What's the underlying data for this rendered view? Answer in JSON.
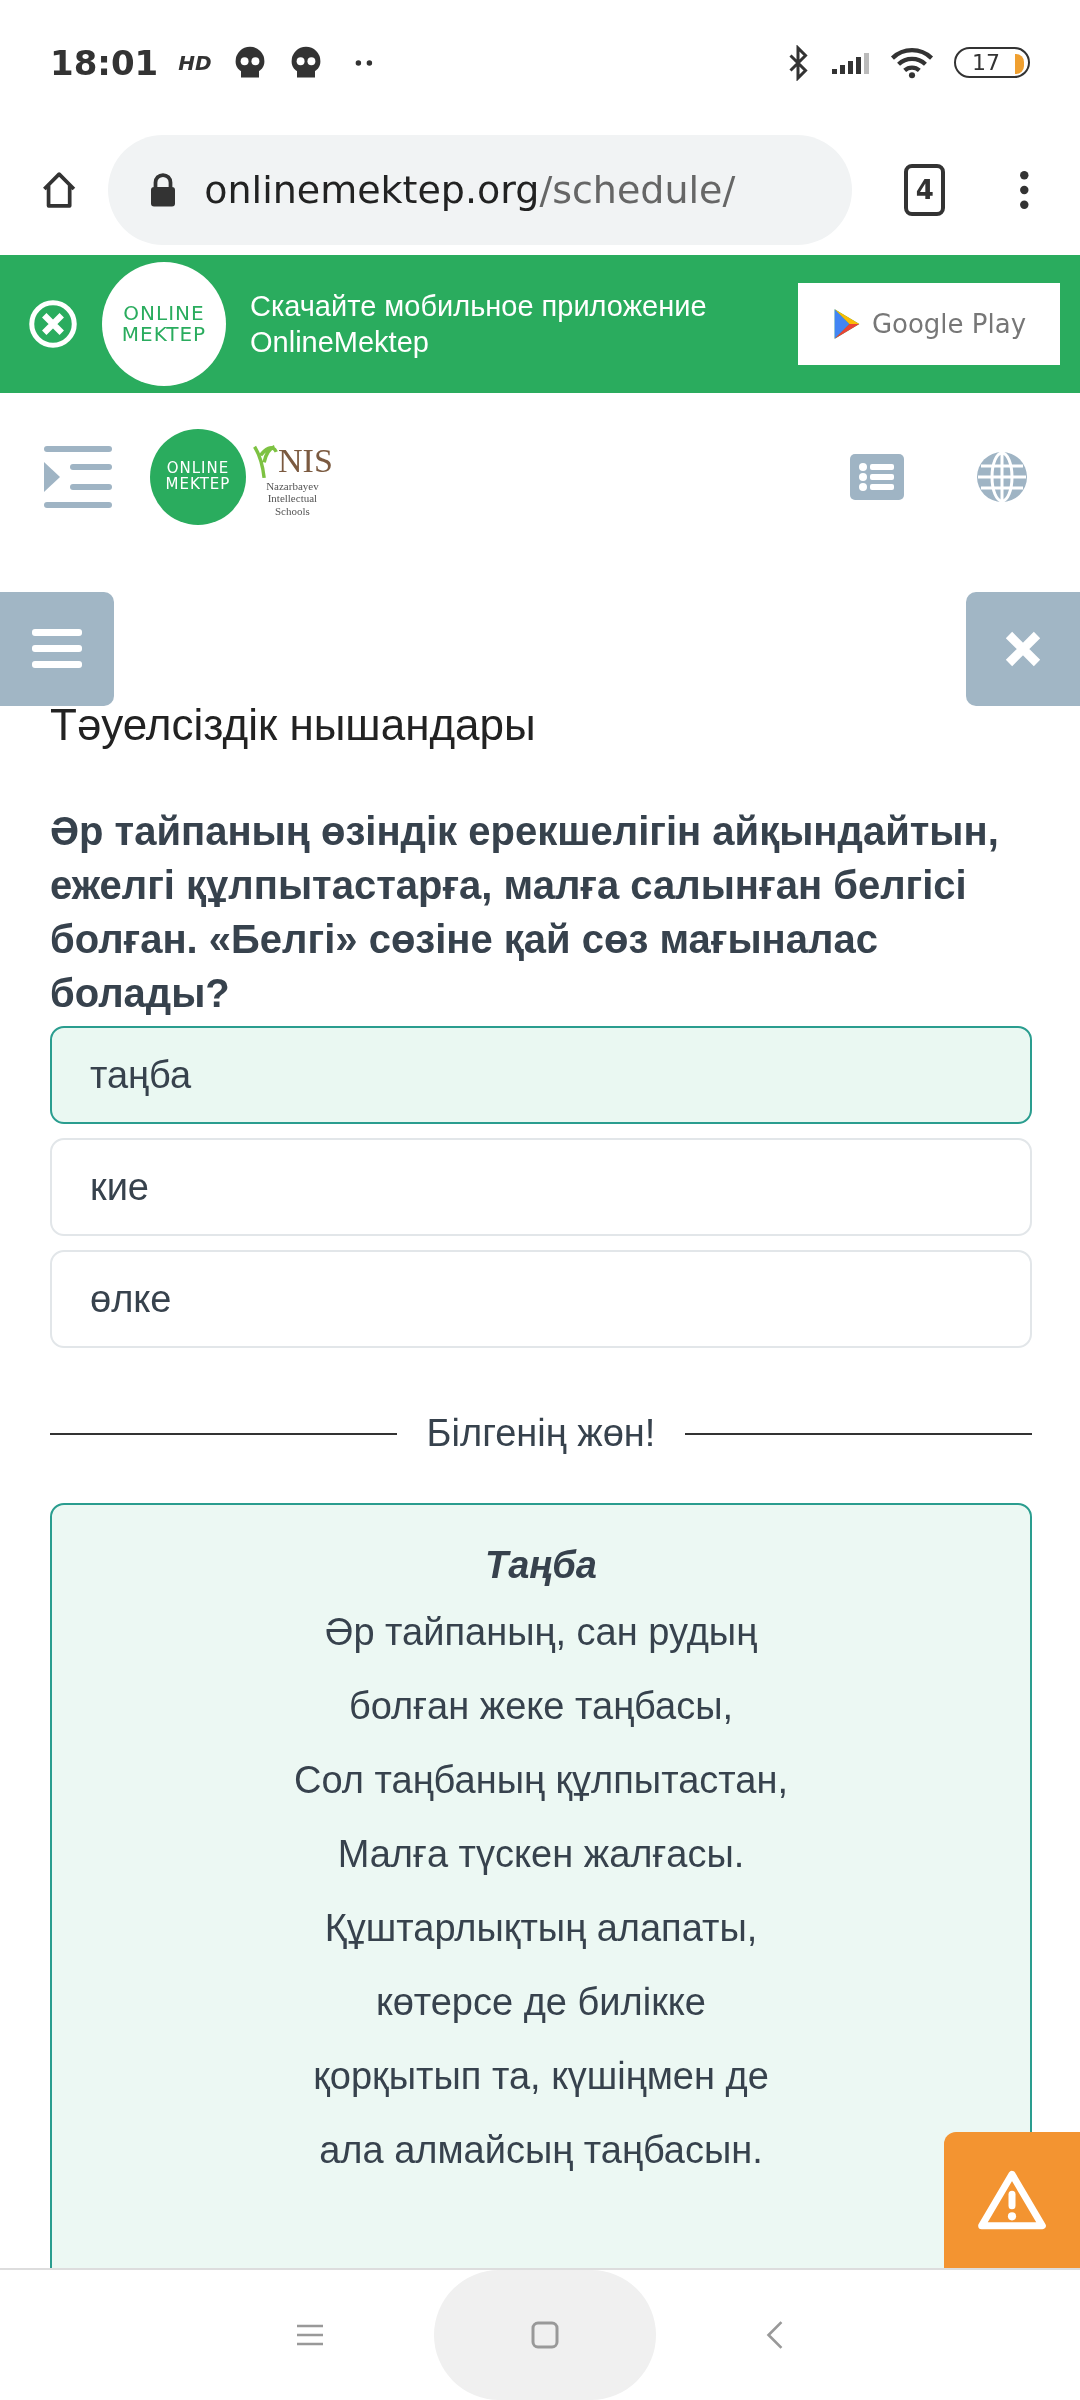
{
  "status_bar": {
    "time": "18:01",
    "hd": "HD",
    "battery": "17"
  },
  "browser": {
    "url_host": "onlinemektep.org",
    "url_path": "/schedule/",
    "tab_count": "4"
  },
  "banner": {
    "logo_line1": "ONLINE",
    "logo_line2": "MEKTEP",
    "text": "Скачайте мобильное приложение OnlineMektep",
    "store": "Google Play"
  },
  "header": {
    "logo_line1": "ONLINE",
    "logo_line2": "MEKTEP",
    "nis": "NIS",
    "nis_sub": [
      "Nazarbayev",
      "Intellectual",
      "Schools"
    ]
  },
  "lesson": {
    "title": "Тәуелсіздік нышандары",
    "question": "Әр тайпаның өзіндік ерекшелігін айқындайтын, ежелгі құлпытастарға, малға салынған белгісі болған. «Белгі» сөзіне қай сөз мағыналас болады?",
    "options": [
      {
        "label": "таңба",
        "selected": true
      },
      {
        "label": "кие",
        "selected": false
      },
      {
        "label": "өлке",
        "selected": false
      }
    ],
    "divider": "Білгенің жөн!",
    "info": {
      "title": "Таңба",
      "lines": [
        "Әр тайпаның, сан рудың",
        "болған жеке таңбасы,",
        "Сол таңбаның құлпытастан,",
        "Малға түскен жалғасы.",
        "Құштарлықтың алапаты,",
        "көтерсе де билікке",
        "қорқытып та, күшіңмен де",
        "ала алмайсың таңбасын."
      ]
    }
  }
}
